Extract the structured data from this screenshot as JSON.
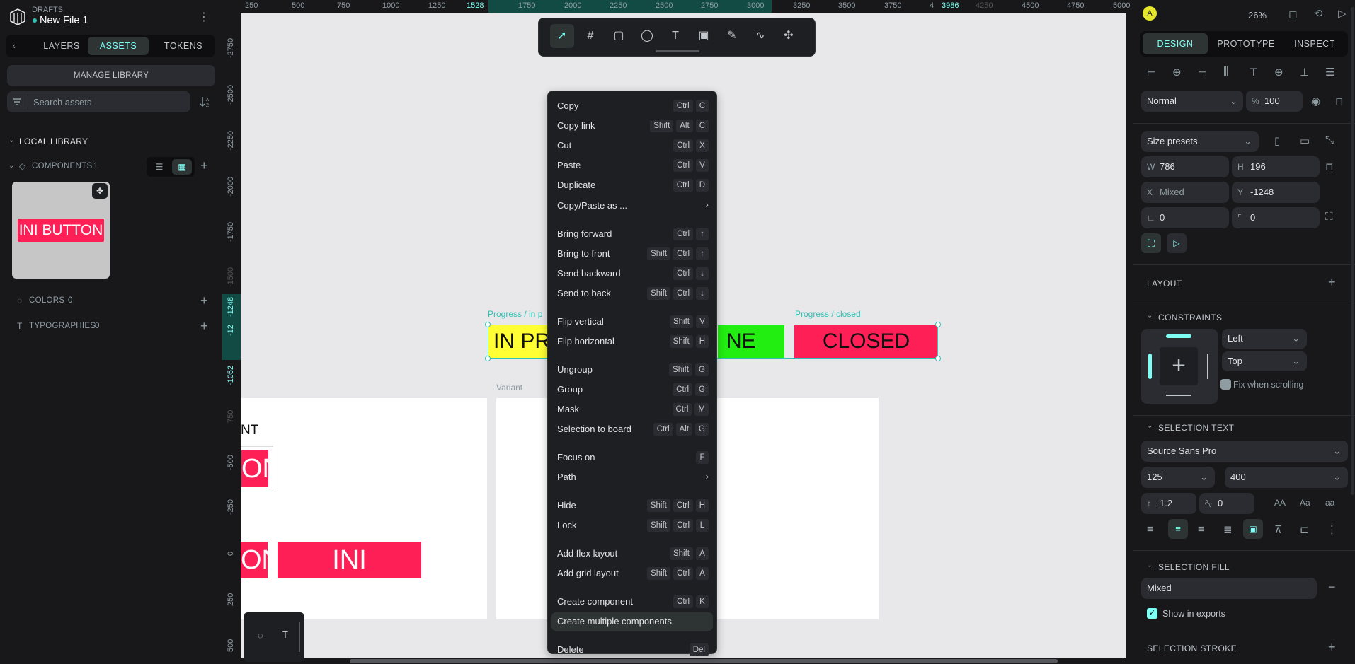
{
  "file": {
    "project": "DRAFTS",
    "name": "New File 1"
  },
  "left_tabs": [
    "LAYERS",
    "ASSETS",
    "TOKENS"
  ],
  "manage_library": "MANAGE LIBRARY",
  "search": {
    "placeholder": "Search assets"
  },
  "local_library": "LOCAL LIBRARY",
  "components": {
    "label": "COMPONENTS",
    "count": "1",
    "thumb_text": "INI BUTTON"
  },
  "colors": {
    "label": "COLORS",
    "count": "0"
  },
  "typographies": {
    "label": "TYPOGRAPHIES",
    "count": "0"
  },
  "ruler_top": [
    "250",
    "500",
    "750",
    "1000",
    "1250",
    "1528",
    "1750",
    "2000",
    "2250",
    "2500",
    "2750",
    "3000",
    "3250",
    "3500",
    "3750",
    "4",
    "3986",
    "4250",
    "4500",
    "4750",
    "5000"
  ],
  "ruler_left": [
    "-2750",
    "-2500",
    "-2250",
    "-2000",
    "-1750",
    "-1500",
    "-1248",
    "-12",
    "-1052",
    "750",
    "-500",
    "-250",
    "0",
    "250",
    "500"
  ],
  "canvas": {
    "label_progress_in": "Progress / in p",
    "label_progress_closed": "Progress / closed",
    "label_variant": "Variant",
    "chip_in": "IN PR",
    "chip_done": "NE",
    "chip_closed": "CLOSED",
    "board_text_nt": "NT",
    "board_text_on1": "ON",
    "board_text_on2": "ON",
    "board_text_btn": "INI BUTTON"
  },
  "menu": [
    {
      "label": "Copy",
      "keys": [
        "Ctrl",
        "C"
      ]
    },
    {
      "label": "Copy link",
      "keys": [
        "Shift",
        "Alt",
        "C"
      ]
    },
    {
      "label": "Cut",
      "keys": [
        "Ctrl",
        "X"
      ]
    },
    {
      "label": "Paste",
      "keys": [
        "Ctrl",
        "V"
      ]
    },
    {
      "label": "Duplicate",
      "keys": [
        "Ctrl",
        "D"
      ]
    },
    {
      "label": "Copy/Paste as ...",
      "keys": [],
      "submenu": true
    },
    {
      "label": "Bring forward",
      "keys": [
        "Ctrl",
        "↑"
      ]
    },
    {
      "label": "Bring to front",
      "keys": [
        "Shift",
        "Ctrl",
        "↑"
      ]
    },
    {
      "label": "Send backward",
      "keys": [
        "Ctrl",
        "↓"
      ]
    },
    {
      "label": "Send to back",
      "keys": [
        "Shift",
        "Ctrl",
        "↓"
      ]
    },
    {
      "label": "Flip vertical",
      "keys": [
        "Shift",
        "V"
      ]
    },
    {
      "label": "Flip horizontal",
      "keys": [
        "Shift",
        "H"
      ]
    },
    {
      "label": "Ungroup",
      "keys": [
        "Shift",
        "G"
      ]
    },
    {
      "label": "Group",
      "keys": [
        "Ctrl",
        "G"
      ]
    },
    {
      "label": "Mask",
      "keys": [
        "Ctrl",
        "M"
      ]
    },
    {
      "label": "Selection to board",
      "keys": [
        "Ctrl",
        "Alt",
        "G"
      ]
    },
    {
      "label": "Focus on",
      "keys": [
        "F"
      ]
    },
    {
      "label": "Path",
      "keys": [],
      "submenu": true
    },
    {
      "label": "Hide",
      "keys": [
        "Shift",
        "Ctrl",
        "H"
      ]
    },
    {
      "label": "Lock",
      "keys": [
        "Shift",
        "Ctrl",
        "L"
      ]
    },
    {
      "label": "Add flex layout",
      "keys": [
        "Shift",
        "A"
      ]
    },
    {
      "label": "Add grid layout",
      "keys": [
        "Shift",
        "Ctrl",
        "A"
      ]
    },
    {
      "label": "Create component",
      "keys": [
        "Ctrl",
        "K"
      ]
    },
    {
      "label": "Create multiple components",
      "keys": [],
      "hover": true
    },
    {
      "label": "Delete",
      "keys": [
        "Del"
      ]
    }
  ],
  "right": {
    "avatar": "A",
    "zoom": "26%",
    "tabs": [
      "DESIGN",
      "PROTOTYPE",
      "INSPECT"
    ],
    "blend": "Normal",
    "opacity_pre": "%",
    "opacity": "100",
    "size_presets": "Size presets",
    "w_label": "W",
    "w": "786",
    "h_label": "H",
    "h": "196",
    "x_label": "X",
    "x": "Mixed",
    "y_label": "Y",
    "y": "-1248",
    "rotation": "0",
    "radius": "0",
    "layout": "LAYOUT",
    "constraints": "CONSTRAINTS",
    "constraint_h": "Left",
    "constraint_v": "Top",
    "fix_scroll": "Fix when scrolling",
    "selection_text": "SELECTION TEXT",
    "font_family": "Source Sans Pro",
    "font_size": "125",
    "font_weight": "400",
    "line_height": "1.2",
    "letter_spacing": "0",
    "case_upper": "AA",
    "case_title": "Aa",
    "case_lower": "aa",
    "selection_fill": "SELECTION FILL",
    "fill_value": "Mixed",
    "show_exports": "Show in exports",
    "selection_stroke": "SELECTION STROKE"
  },
  "colors_ui": {
    "accent": "#7efff5",
    "teal": "#2fc2b3",
    "pink": "#ff1f57",
    "yellow": "#ffff33",
    "green": "#22ee11"
  }
}
